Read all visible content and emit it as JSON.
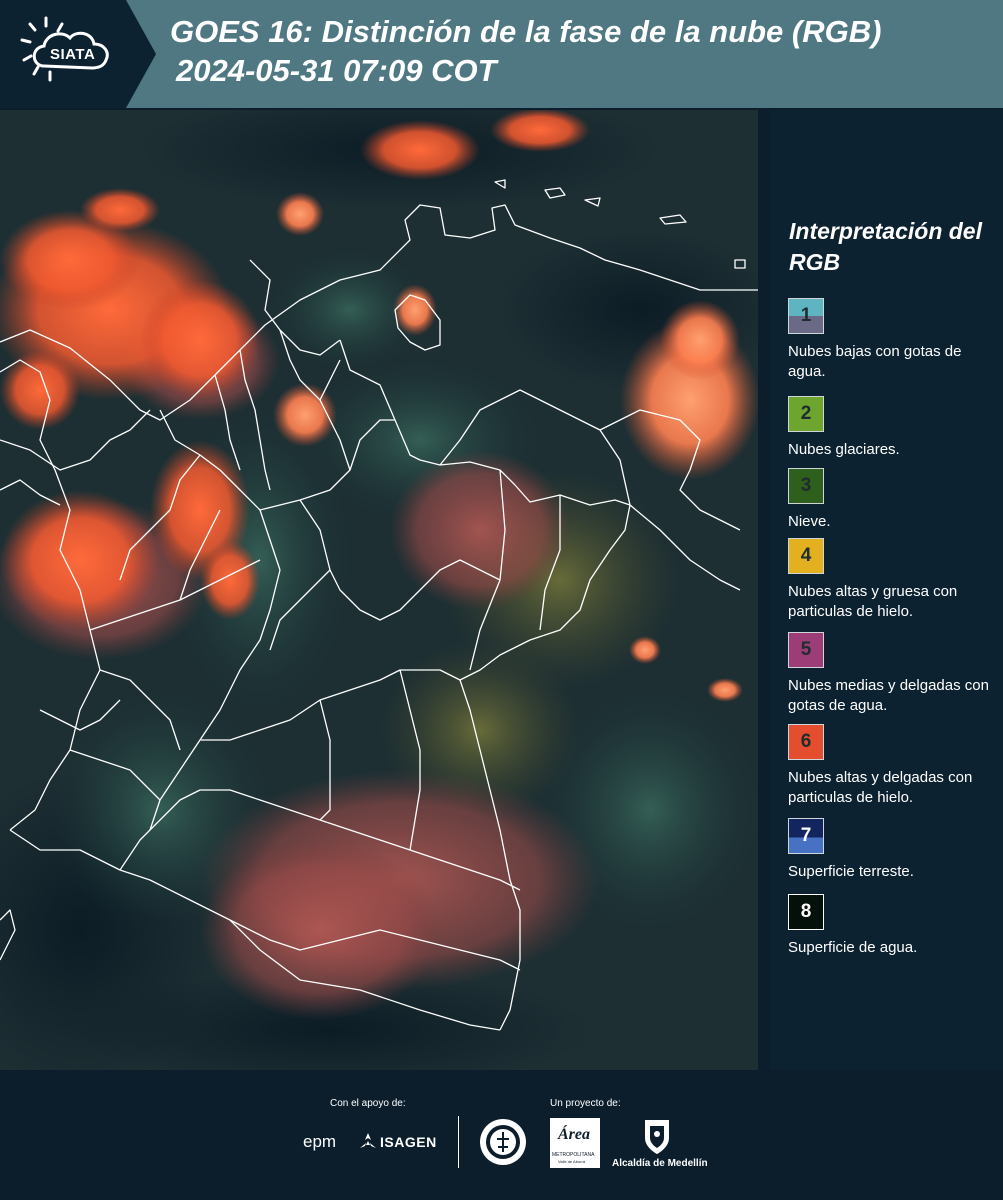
{
  "header": {
    "logo_text": "SIATA",
    "title_line1": "GOES 16: Distinción de la fase de la nube (RGB)",
    "title_line2": "2024-05-31 07:09 COT",
    "background_color": "#4f7883"
  },
  "map": {
    "region": "Colombia",
    "borders_color": "#ffffff"
  },
  "legend": {
    "title": "Interpretación del RGB",
    "items": [
      {
        "number": "1",
        "label": "Nubes bajas con gotas de agua.",
        "color_top": "#5fb4c2",
        "color_bottom": "#6b6a86"
      },
      {
        "number": "2",
        "label": "Nubes glaciares.",
        "color_top": "#6ea52e",
        "color_bottom": "#6ea52e"
      },
      {
        "number": "3",
        "label": "Nieve.",
        "color_top": "#2e5f1c",
        "color_bottom": "#2e5f1c"
      },
      {
        "number": "4",
        "label": "Nubes altas y gruesa con particulas de hielo.",
        "color_top": "#e3b01f",
        "color_bottom": "#e3b01f"
      },
      {
        "number": "5",
        "label": "Nubes medias y delgadas con gotas de agua.",
        "color_top": "#9d3d78",
        "color_bottom": "#9d3d78"
      },
      {
        "number": "6",
        "label": "Nubes altas y delgadas con particulas de hielo.",
        "color_top": "#e44d2d",
        "color_bottom": "#e44d2d"
      },
      {
        "number": "7",
        "label": "Superficie terreste.",
        "color_top": "#12255f",
        "color_bottom": "#4772c4"
      },
      {
        "number": "8",
        "label": "Superficie de agua.",
        "color_top": "#04110a",
        "color_bottom": "#04110a"
      }
    ]
  },
  "footer": {
    "support_label": "Con el apoyo de:",
    "project_label": "Un proyecto de:",
    "sponsor_epm": "epm",
    "sponsor_isagen": "ISAGEN",
    "partner_area": "Área",
    "partner_area_sub": "METROPOLITANA",
    "partner_area_sub2": "Valle de Aburrá",
    "partner_alcaldia": "Alcaldía de Medellín"
  }
}
